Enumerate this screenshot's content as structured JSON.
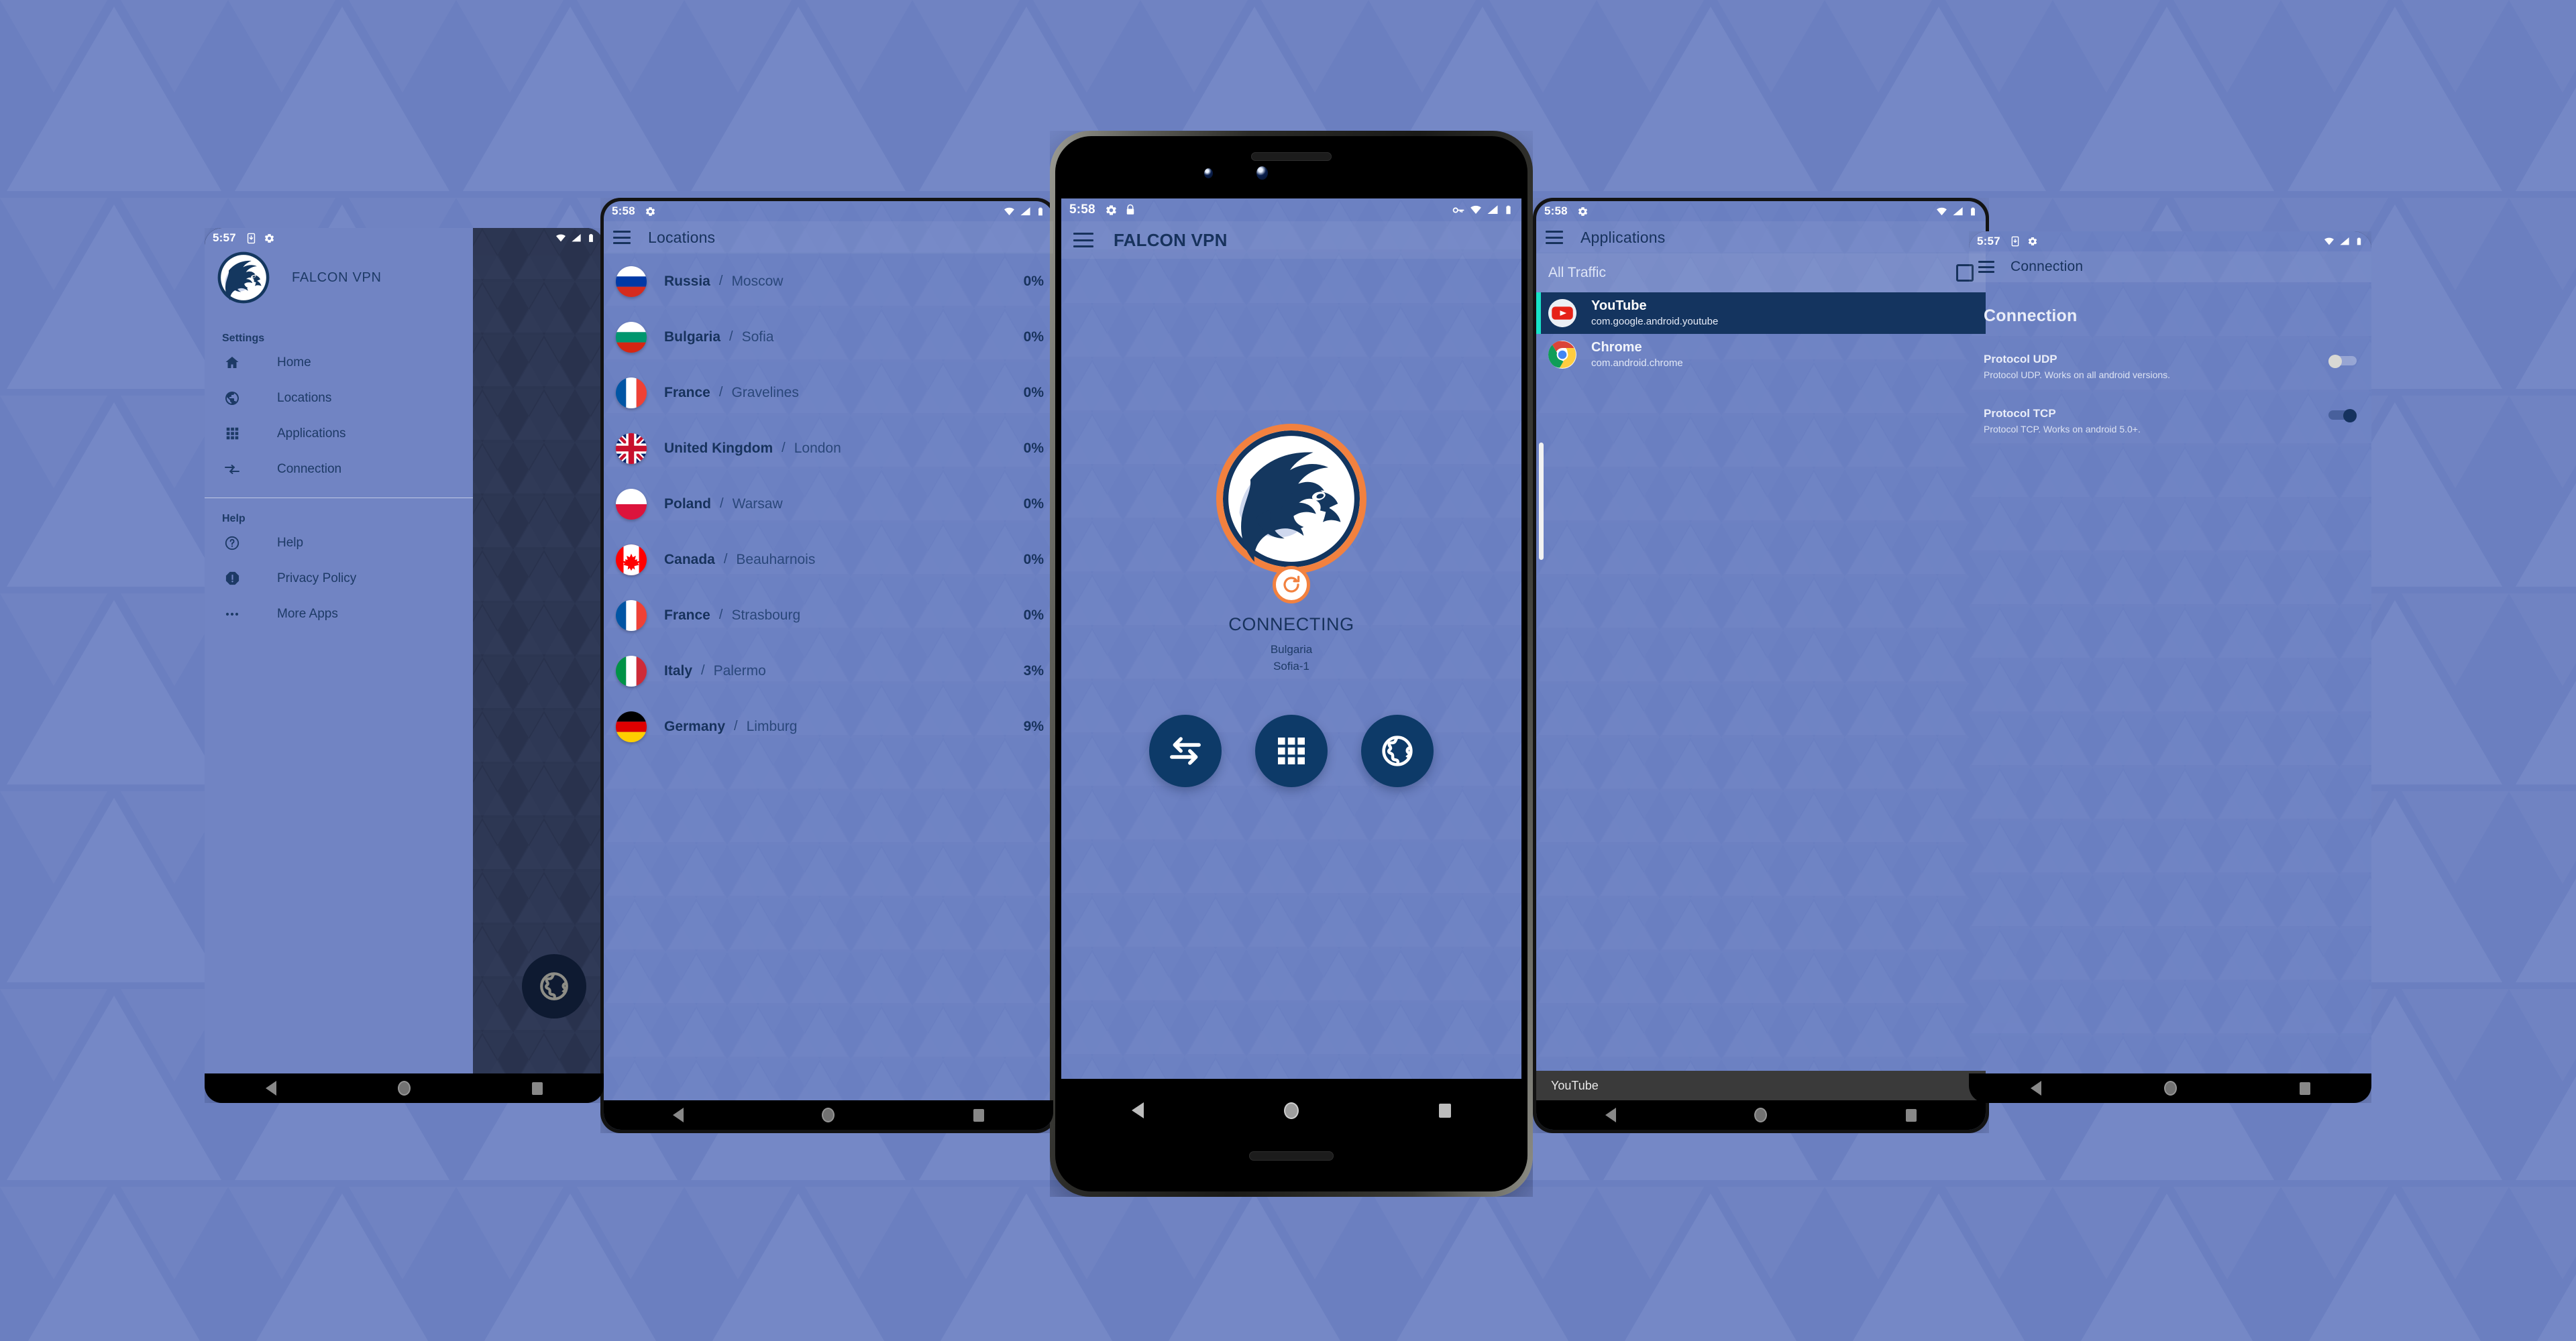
{
  "wallpaper": {
    "color": "#6b7fc0",
    "triangle_color": "#7e90cb"
  },
  "theme": {
    "app_bg": "#6a7fc1",
    "navy": "#17325c",
    "deep_navy": "#0d3a68",
    "orange": "#f2813f",
    "teal_accent": "#18e3c8",
    "selected_row": "#14345f"
  },
  "phone1": {
    "statusbar": {
      "time": "5:57",
      "icons": [
        "download-icon",
        "gear-icon"
      ],
      "right_icons": [
        "wifi-icon",
        "signal-icon",
        "battery-icon"
      ]
    },
    "drawer": {
      "brand": "FALCON VPN",
      "logo_alt": "falcon-logo",
      "sections": [
        {
          "label": "Settings",
          "items": [
            {
              "icon": "home-icon",
              "label": "Home"
            },
            {
              "icon": "globe-icon",
              "label": "Locations"
            },
            {
              "icon": "grid-icon",
              "label": "Applications"
            },
            {
              "icon": "connection-arrows-icon",
              "label": "Connection"
            }
          ]
        },
        {
          "label": "Help",
          "items": [
            {
              "icon": "question-circle-icon",
              "label": "Help"
            },
            {
              "icon": "exclamation-octagon-icon",
              "label": "Privacy Policy"
            },
            {
              "icon": "ellipsis-icon",
              "label": "More Apps"
            }
          ]
        }
      ]
    }
  },
  "phone2": {
    "statusbar": {
      "time": "5:58",
      "icons": [
        "gear-icon"
      ],
      "right_icons": [
        "wifi-icon",
        "signal-icon",
        "battery-icon"
      ]
    },
    "appbar": {
      "menu_icon": "hamburger-icon",
      "title": "Locations"
    },
    "locations": [
      {
        "flag": "ru",
        "country": "Russia",
        "city": "Moscow",
        "load": "0%"
      },
      {
        "flag": "bg",
        "country": "Bulgaria",
        "city": "Sofia",
        "load": "0%"
      },
      {
        "flag": "fr",
        "country": "France",
        "city": "Gravelines",
        "load": "0%"
      },
      {
        "flag": "gb",
        "country": "United Kingdom",
        "city": "London",
        "load": "0%"
      },
      {
        "flag": "pl",
        "country": "Poland",
        "city": "Warsaw",
        "load": "0%"
      },
      {
        "flag": "ca",
        "country": "Canada",
        "city": "Beauharnois",
        "load": "0%"
      },
      {
        "flag": "fr",
        "country": "France",
        "city": "Strasbourg",
        "load": "0%"
      },
      {
        "flag": "it",
        "country": "Italy",
        "city": "Palermo",
        "load": "3%"
      },
      {
        "flag": "de",
        "country": "Germany",
        "city": "Limburg",
        "load": "9%"
      }
    ],
    "separator": "/"
  },
  "phone3": {
    "statusbar": {
      "time": "5:58",
      "icons": [
        "gear-icon",
        "lock-icon"
      ],
      "right_icons": [
        "vpn-key-icon",
        "wifi-icon",
        "signal-icon",
        "battery-icon"
      ]
    },
    "appbar": {
      "menu_icon": "hamburger-icon",
      "title": "FALCON VPN"
    },
    "logo_alt": "falcon-logo",
    "spinner_icon": "refresh-icon",
    "status": {
      "state": "CONNECTING",
      "country": "Bulgaria",
      "server": "Sofia-1"
    },
    "actions": [
      {
        "icon": "transfer-arrows-icon",
        "name": "connection-button"
      },
      {
        "icon": "grid-icon",
        "name": "applications-button"
      },
      {
        "icon": "globe-icon",
        "name": "locations-button"
      }
    ]
  },
  "phone4": {
    "statusbar": {
      "time": "5:58",
      "icons": [
        "gear-icon"
      ],
      "right_icons": [
        "wifi-icon",
        "signal-icon",
        "battery-icon"
      ]
    },
    "appbar": {
      "menu_icon": "hamburger-icon",
      "title": "Applications"
    },
    "all_traffic": {
      "label": "All Traffic",
      "checked": false
    },
    "apps": [
      {
        "icon": "youtube-icon",
        "name": "YouTube",
        "package": "com.google.android.youtube",
        "selected": true
      },
      {
        "icon": "chrome-icon",
        "name": "Chrome",
        "package": "com.android.chrome",
        "selected": false
      }
    ],
    "toast": "YouTube"
  },
  "phone5": {
    "statusbar": {
      "time": "5:57",
      "icons": [
        "download-icon",
        "gear-icon"
      ],
      "right_icons": [
        "wifi-icon",
        "signal-icon",
        "battery-icon"
      ]
    },
    "appbar": {
      "menu_icon": "hamburger-icon",
      "title": "Connection"
    },
    "page_heading": "Connection",
    "protocols": [
      {
        "name": "Protocol UDP",
        "desc": "Protocol UDP. Works on all android versions.",
        "enabled": false
      },
      {
        "name": "Protocol TCP",
        "desc": "Protocol TCP. Works on android 5.0+.",
        "enabled": true
      }
    ]
  }
}
